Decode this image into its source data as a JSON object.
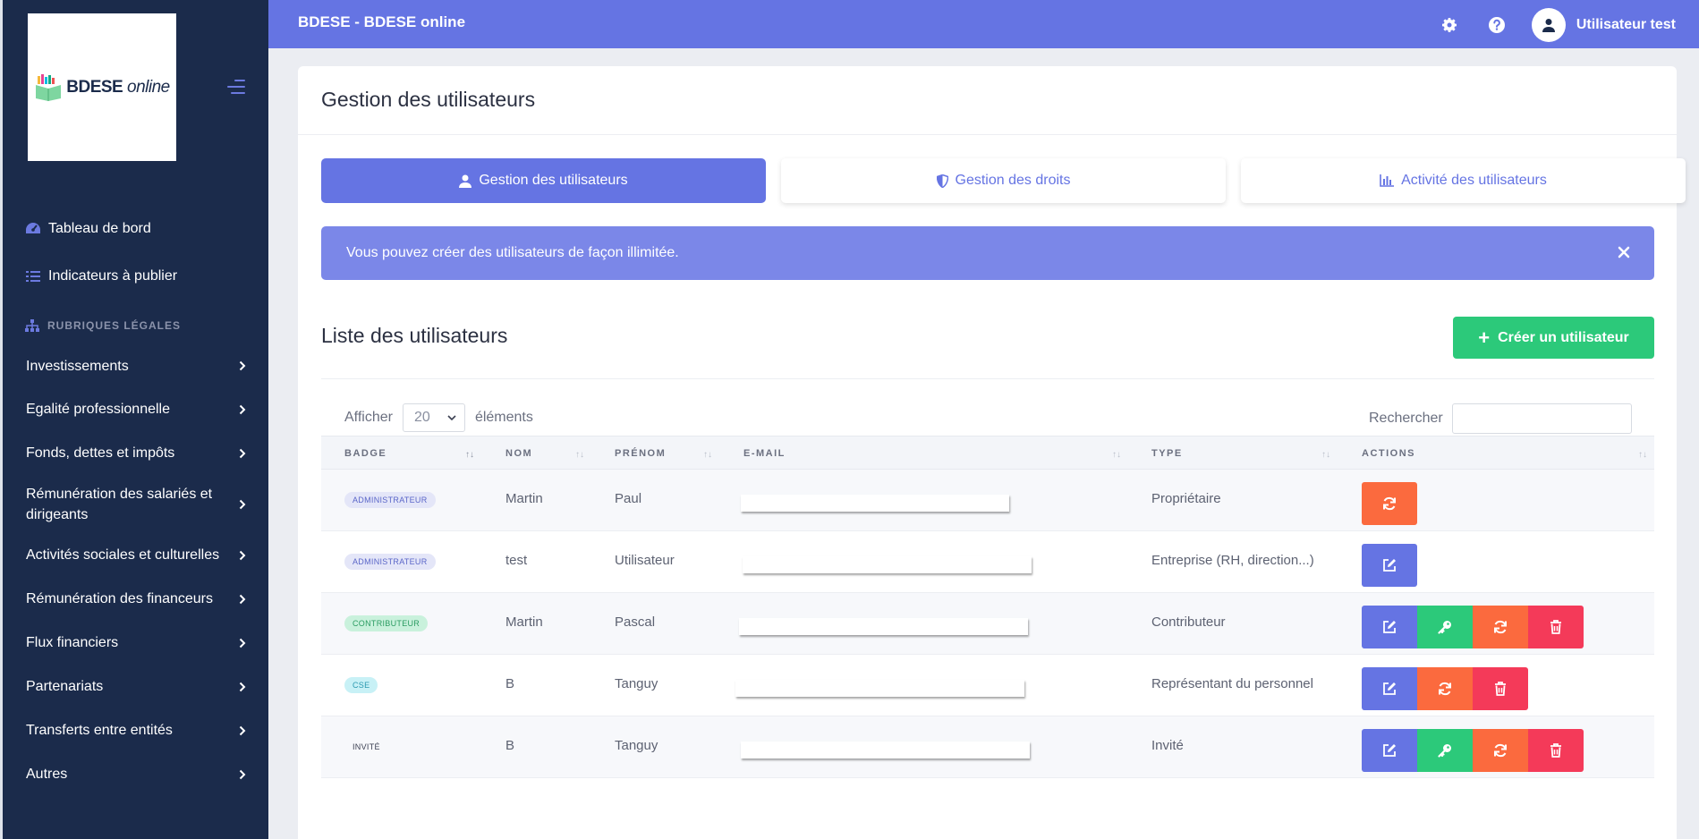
{
  "sidebar": {
    "logo": {
      "text_bold": "BDESE",
      "text_italic": "online"
    },
    "top_items": [
      {
        "label": "Tableau de bord",
        "icon": "dashboard-icon"
      },
      {
        "label": "Indicateurs à publier",
        "icon": "list-icon"
      }
    ],
    "section_label": "RUBRIQUES LÉGALES",
    "items": [
      {
        "label": "Investissements"
      },
      {
        "label": "Egalité professionnelle"
      },
      {
        "label": "Fonds, dettes et impôts"
      },
      {
        "label": "Rémunération des salariés et dirigeants"
      },
      {
        "label": "Activités sociales et culturelles"
      },
      {
        "label": "Rémunération des financeurs"
      },
      {
        "label": "Flux financiers"
      },
      {
        "label": "Partenariats"
      },
      {
        "label": "Transferts entre entités"
      },
      {
        "label": "Autres"
      }
    ]
  },
  "topbar": {
    "title": "BDESE - BDESE online",
    "username": "Utilisateur test"
  },
  "card": {
    "title": "Gestion des utilisateurs",
    "tabs": [
      {
        "label": "Gestion des utilisateurs",
        "active": true
      },
      {
        "label": "Gestion des droits",
        "active": false
      },
      {
        "label": "Activité des utilisateurs",
        "active": false
      }
    ],
    "alert": "Vous pouvez créer des utilisateurs de façon illimitée.",
    "list_title": "Liste des utilisateurs",
    "create_button": "Créer un utilisateur",
    "show_label": "Afficher",
    "page_size": "20",
    "elements_label": "éléments",
    "search_label": "Rechercher",
    "search_value": ""
  },
  "table": {
    "columns": [
      "BADGE",
      "NOM",
      "PRÉNOM",
      "E-MAIL",
      "TYPE",
      "ACTIONS"
    ],
    "rows": [
      {
        "badge": "ADMINISTRATEUR",
        "badge_kind": "admin",
        "nom": "Martin",
        "prenom": "Paul",
        "type": "Propriétaire",
        "actions": [
          "reset"
        ]
      },
      {
        "badge": "ADMINISTRATEUR",
        "badge_kind": "admin",
        "nom": "test",
        "prenom": "Utilisateur",
        "type": "Entreprise (RH, direction...)",
        "actions": [
          "edit"
        ]
      },
      {
        "badge": "CONTRIBUTEUR",
        "badge_kind": "contrib",
        "nom": "Martin",
        "prenom": "Pascal",
        "type": "Contributeur",
        "actions": [
          "edit",
          "key",
          "reset",
          "delete"
        ]
      },
      {
        "badge": "CSE",
        "badge_kind": "cse",
        "nom": "B",
        "prenom": "Tanguy",
        "type": "Représentant du personnel",
        "actions": [
          "edit",
          "reset",
          "delete"
        ]
      },
      {
        "badge": "INVITÉ",
        "badge_kind": "invite",
        "nom": "B",
        "prenom": "Tanguy",
        "type": "Invité",
        "actions": [
          "edit",
          "key",
          "reset",
          "delete"
        ]
      }
    ]
  },
  "colors": {
    "primary": "#6574e3",
    "sidebar": "#1b2b4b",
    "success": "#2cc97a",
    "warning": "#fb6a3e",
    "danger": "#f43a59"
  }
}
